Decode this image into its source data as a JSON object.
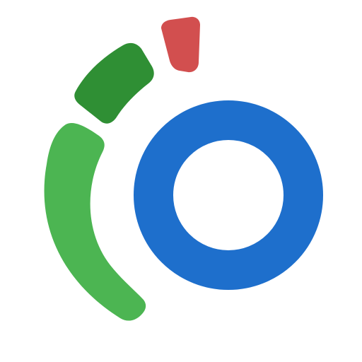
{
  "logo": {
    "icon": "segmented-ring-logo",
    "colors": {
      "background": "#ffffff",
      "ring": "#1e6fcc",
      "segment_large": "#4cb552",
      "segment_medium": "#2f8f34",
      "segment_small": "#d24f4f"
    }
  }
}
